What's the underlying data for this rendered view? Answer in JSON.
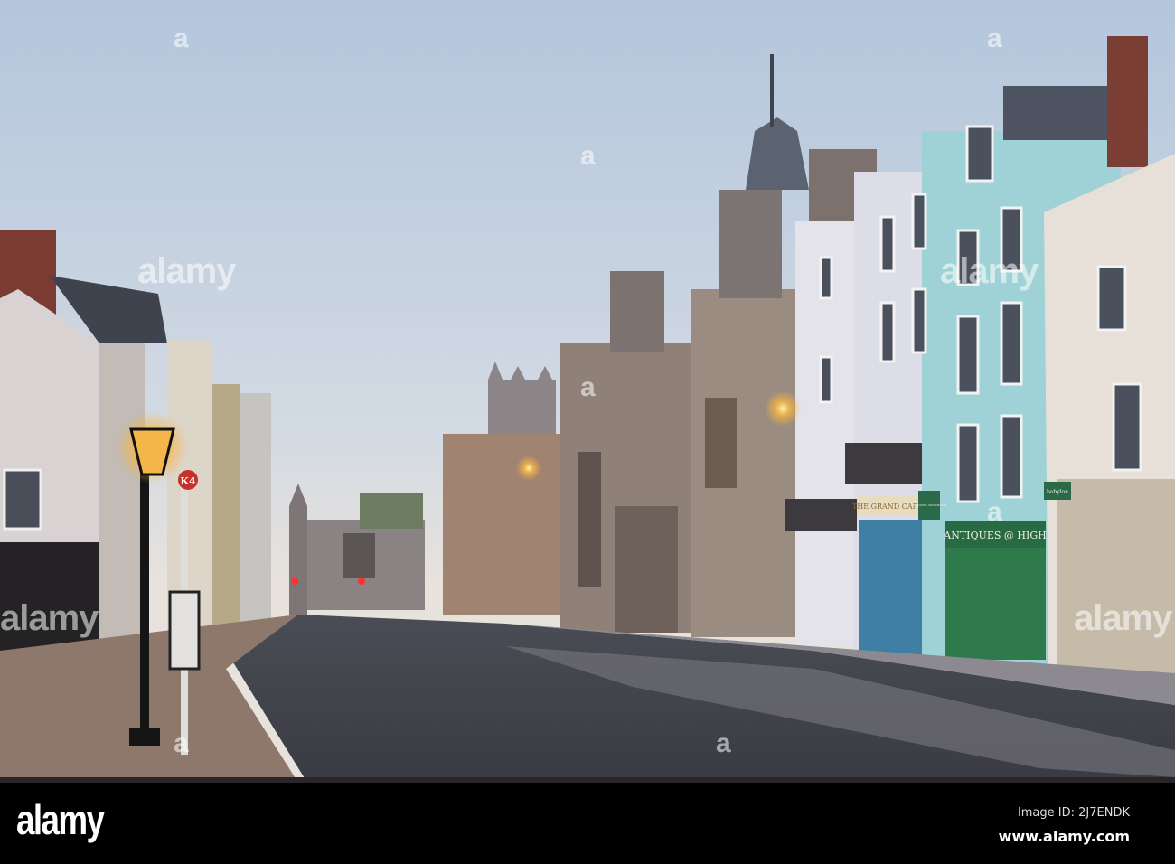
{
  "watermark": {
    "brand": "alamy",
    "letter": "a"
  },
  "signs": {
    "antiques": "ANTIQUES @ HIGH",
    "grand_cafe": "THE GRAND CAFE",
    "antiques_crafts": "ANTIQUES AND CRAFTS",
    "babylon": "babylon",
    "bus_stop": "K4"
  },
  "footer": {
    "logo": "alamy",
    "image_id": "Image ID: 2J7ENDK",
    "website": "www.alamy.com"
  }
}
